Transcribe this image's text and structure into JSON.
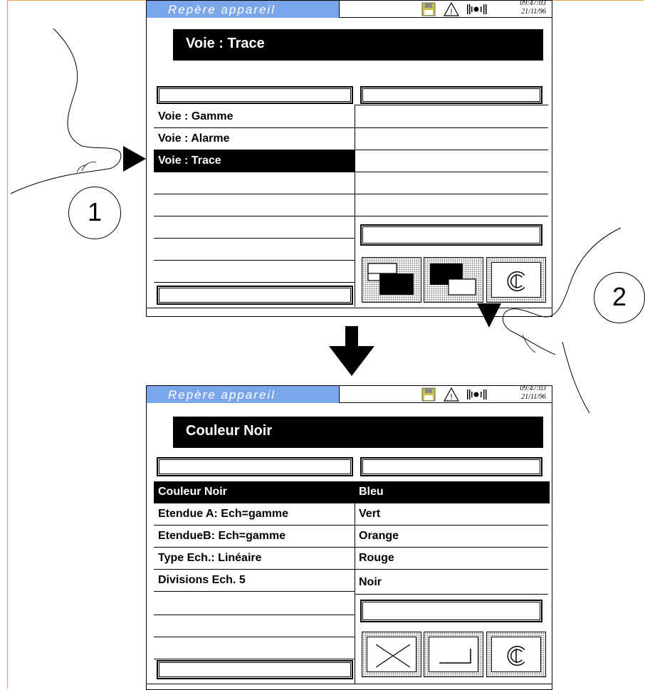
{
  "screen1": {
    "app_title": "Repère  appareil",
    "time": "09:47:03",
    "date": "21/11/96",
    "header": "Voie : Trace",
    "left_items": [
      "Voie : Gamme",
      "Voie : Alarme",
      "Voie : Trace"
    ],
    "selected_index": 2
  },
  "screen2": {
    "app_title": "Repère  appareil",
    "time": "09:47:03",
    "date": "21/11/96",
    "header": "Couleur  Noir",
    "left_items": [
      "Couleur Noir",
      "Etendue A: Ech=gamme",
      "EtendueB: Ech=gamme",
      "Type Ech.: Linéaire",
      "Divisions Ech.   5"
    ],
    "right_items": [
      "Bleu",
      "Vert",
      "Orange",
      "Rouge",
      "Noir"
    ],
    "selected_index": 0
  },
  "callouts": {
    "step1": "1",
    "step2": "2"
  },
  "icons": {
    "status": [
      "floppy-disk-icon",
      "warning-triangle-icon",
      "signal-bars-icon"
    ],
    "buttons_screen1": [
      "page-back-icon",
      "page-forward-icon",
      "copyright-c-icon"
    ],
    "buttons_screen2": [
      "cancel-x-icon",
      "enter-icon",
      "copyright-c-icon"
    ]
  },
  "colors": {
    "title_bar": "#7aa7ea",
    "floppy": "#c8c040",
    "page_border": "#f0a34a"
  }
}
